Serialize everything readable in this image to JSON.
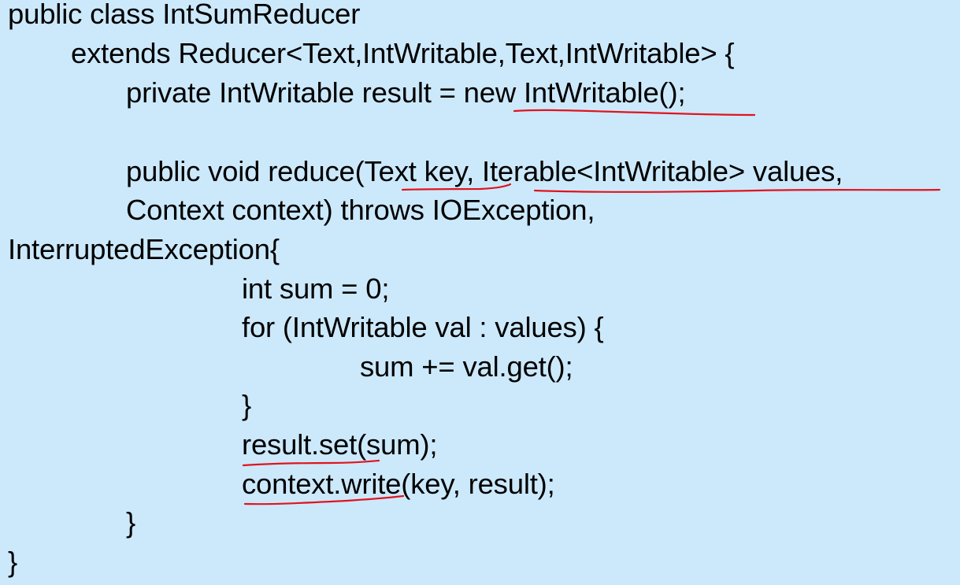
{
  "code": {
    "lines": [
      "public class IntSumReducer",
      "extends Reducer<Text,IntWritable,Text,IntWritable> {",
      "private IntWritable result = new IntWritable();",
      "",
      "public void reduce(Text key, Iterable<IntWritable> values,",
      "Context context) throws IOException,",
      "InterruptedException{",
      "int sum = 0;",
      "for (IntWritable val : values) {",
      "sum += val.get();",
      "}",
      "result.set(sum);",
      "context.write(key, result);",
      "}",
      "}"
    ]
  },
  "colors": {
    "background": "#cce9fb",
    "text": "#000000",
    "annotation": "#e0141e"
  }
}
